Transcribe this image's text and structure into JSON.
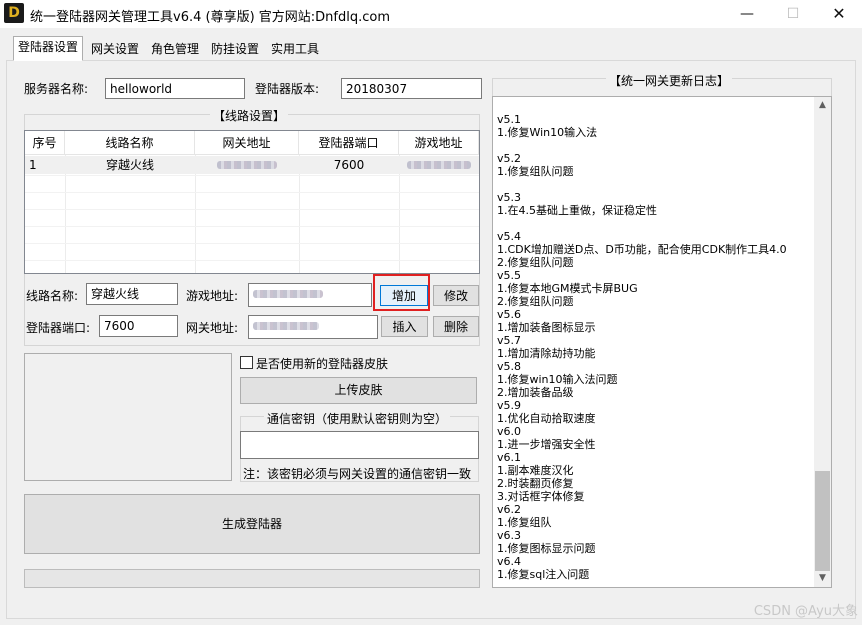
{
  "window": {
    "logo_letter": "D",
    "title": "统一登陆器网关管理工具v6.4 (尊享版)  官方网站:Dnfdlq.com",
    "minimize": "—",
    "maximize": "☐",
    "close": "✕"
  },
  "tabs": [
    "登陆器设置",
    "网关设置",
    "角色管理",
    "防挂设置",
    "实用工具"
  ],
  "server": {
    "name_label": "服务器名称:",
    "name_value": "helloworld",
    "version_label": "登陆器版本:",
    "version_value": "20180307"
  },
  "route_settings": {
    "title": "【线路设置】",
    "columns": [
      "序号",
      "线路名称",
      "网关地址",
      "登陆器端口",
      "游戏地址"
    ],
    "rows": [
      {
        "index": "1",
        "name": "穿越火线",
        "gateway": "",
        "port": "7600",
        "game": ""
      }
    ],
    "route_name_label": "线路名称:",
    "route_name_value": "穿越火线",
    "game_addr_label": "游戏地址:",
    "game_addr_value": "",
    "port_label": "登陆器端口:",
    "port_value": "7600",
    "gateway_label": "网关地址:",
    "gateway_value": "",
    "add_button": "增加",
    "edit_button": "修改",
    "insert_button": "插入",
    "delete_button": "删除"
  },
  "skin": {
    "checkbox_label": "是否使用新的登陆器皮肤",
    "upload_button": "上传皮肤"
  },
  "secret": {
    "title": "通信密钥（使用默认密钥则为空）",
    "value": "",
    "note": "注：该密钥必须与网关设置的通信密钥一致"
  },
  "generate_button": "生成登陆器",
  "log": {
    "title": "【统一网关更新日志】",
    "text": "v5.1\n1.修复Win10输入法\n\nv5.2\n1.修复组队问题\n\nv5.3\n1.在4.5基础上重做，保证稳定性\n\nv5.4\n1.CDK增加赠送D点、D币功能，配合使用CDK制作工具4.0\n2.修复组队问题\nv5.5\n1.修复本地GM模式卡屏BUG\n2.修复组队问题\nv5.6\n1.增加装备图标显示\nv5.7\n1.增加清除劫持功能\nv5.8\n1.修复win10输入法问题\n2.增加装备品级\nv5.9\n1.优化自动拾取速度\nv6.0\n1.进一步增强安全性\nv6.1\n1.副本难度汉化\n2.时装翻页修复\n3.对话框字体修复\nv6.2\n1.修复组队\nv6.3\n1.修复图标显示问题\nv6.4\n1.修复sql注入问题"
  },
  "watermark": "CSDN @Ayu大象",
  "colors": {
    "highlight_border": "#e02020",
    "selected_row": "#f0f0f0"
  }
}
